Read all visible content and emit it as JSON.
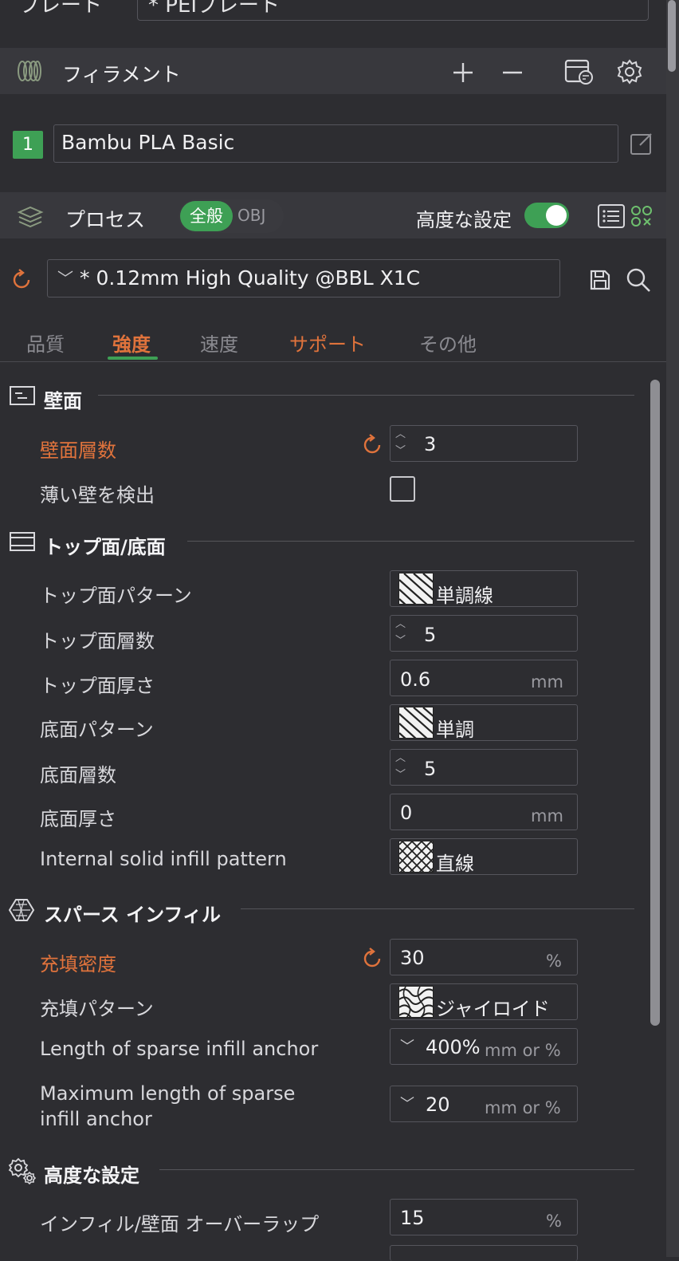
{
  "plate": {
    "label": "プレート",
    "value": "* PEIプレート"
  },
  "filament": {
    "title": "フィラメント",
    "slot": "1",
    "name": "Bambu PLA Basic"
  },
  "process": {
    "title": "プロセス",
    "toggle_on": "全般",
    "toggle_off": "OBJ",
    "advanced_label": "高度な設定",
    "preset": "* 0.12mm High Quality @BBL X1C"
  },
  "tabs": [
    "品質",
    "強度",
    "速度",
    "サポート",
    "その他"
  ],
  "groups": {
    "walls": {
      "title": "壁面"
    },
    "topbottom": {
      "title": "トップ面/底面"
    },
    "infill": {
      "title": "スパース インフィル"
    },
    "advanced": {
      "title": "高度な設定"
    }
  },
  "settings": {
    "wall_loops": {
      "label": "壁面層数",
      "value": "3"
    },
    "detect_thin_wall": {
      "label": "薄い壁を検出",
      "checked": false
    },
    "top_pattern": {
      "label": "トップ面パターン",
      "value": "単調線"
    },
    "top_layers": {
      "label": "トップ面層数",
      "value": "5"
    },
    "top_thickness": {
      "label": "トップ面厚さ",
      "value": "0.6",
      "unit": "mm"
    },
    "bottom_pattern": {
      "label": "底面パターン",
      "value": "単調"
    },
    "bottom_layers": {
      "label": "底面層数",
      "value": "5"
    },
    "bottom_thickness": {
      "label": "底面厚さ",
      "value": "0",
      "unit": "mm"
    },
    "internal_solid_pattern": {
      "label": "Internal solid infill pattern",
      "value": "直線"
    },
    "infill_density": {
      "label": "充填密度",
      "value": "30",
      "unit": "%"
    },
    "infill_pattern": {
      "label": "充填パターン",
      "value": "ジャイロイド"
    },
    "anchor_length": {
      "label": "Length of sparse infill anchor",
      "value": "400%",
      "unit": "mm or %"
    },
    "anchor_max_l1": "Maximum length of sparse",
    "anchor_max_l2": "infill anchor",
    "anchor_max": {
      "value": "20",
      "unit": "mm or %"
    },
    "infill_wall_overlap": {
      "label": "インフィル/壁面 オーバーラップ",
      "value": "15",
      "unit": "%"
    }
  },
  "colors": {
    "accent": "#3ea055",
    "modified": "#e0733c",
    "bg": "#2d2d31",
    "bar": "#38383d"
  }
}
